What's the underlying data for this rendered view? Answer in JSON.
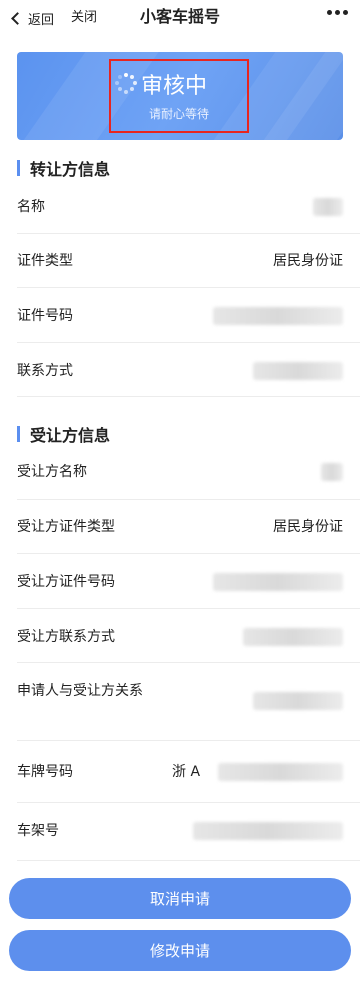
{
  "nav": {
    "back_label": "返回",
    "close_label": "关闭",
    "title": "小客车摇号"
  },
  "status": {
    "title": "审核中",
    "subtitle": "请耐心等待"
  },
  "transferor": {
    "section_title": "转让方信息",
    "name_label": "名称",
    "id_type_label": "证件类型",
    "id_type_value": "居民身份证",
    "id_number_label": "证件号码",
    "contact_label": "联系方式"
  },
  "transferee": {
    "section_title": "受让方信息",
    "name_label": "受让方名称",
    "id_type_label": "受让方证件类型",
    "id_type_value": "居民身份证",
    "id_number_label": "受让方证件号码",
    "contact_label": "受让方联系方式",
    "relation_label": "申请人与受让方关系",
    "plate_label": "车牌号码",
    "plate_prefix": "浙 A",
    "vin_label": "车架号"
  },
  "actions": {
    "cancel_label": "取消申请",
    "modify_label": "修改申请"
  },
  "colors": {
    "accent": "#5d8fed",
    "highlight_border": "#e8251f"
  }
}
